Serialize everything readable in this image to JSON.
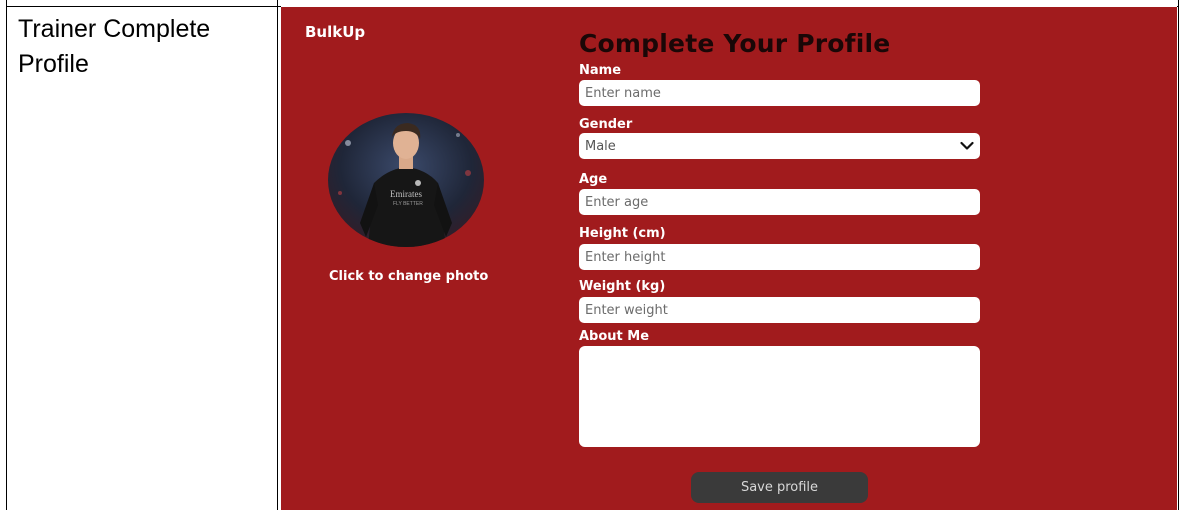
{
  "table": {
    "row_label": "Trainer Complete Profile"
  },
  "app": {
    "brand": "BulkUp",
    "title": "Complete Your Profile",
    "photo": {
      "change_label": "Click to change photo"
    },
    "form": {
      "name": {
        "label": "Name",
        "placeholder": "Enter name"
      },
      "gender": {
        "label": "Gender",
        "value": "Male"
      },
      "age": {
        "label": "Age",
        "placeholder": "Enter age"
      },
      "height": {
        "label": "Height (cm)",
        "placeholder": "Enter height"
      },
      "weight": {
        "label": "Weight (kg)",
        "placeholder": "Enter weight"
      },
      "about": {
        "label": "About Me"
      }
    },
    "save_label": "Save profile"
  },
  "colors": {
    "app_background": "#a11b1d",
    "title_color": "#1a0707",
    "button_background": "#3a3a3a"
  },
  "icons": {
    "gender_dropdown": "chevron-down-icon"
  }
}
